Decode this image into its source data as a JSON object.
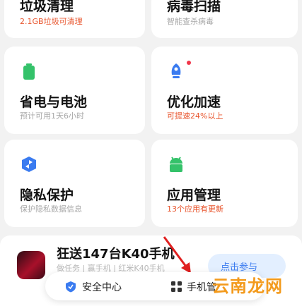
{
  "cards": [
    {
      "title": "垃圾清理",
      "sub": "2.1GB垃圾可清理",
      "sub_color": "orange",
      "icon": "trash-icon"
    },
    {
      "title": "病毒扫描",
      "sub": "智能查杀病毒",
      "sub_color": "gray",
      "icon": "virus-scan-icon"
    },
    {
      "title": "省电与电池",
      "sub": "预计可用1天6小时",
      "sub_color": "gray",
      "icon": "battery-icon"
    },
    {
      "title": "优化加速",
      "sub": "可提速24%以上",
      "sub_color": "orange",
      "icon": "rocket-icon"
    },
    {
      "title": "隐私保护",
      "sub": "保护隐私数据信息",
      "sub_color": "gray",
      "icon": "privacy-shield-icon"
    },
    {
      "title": "应用管理",
      "sub": "13个应用有更新",
      "sub_color": "orange",
      "icon": "android-icon"
    }
  ],
  "promo": {
    "title": "狂送147台K40手机",
    "sub": "做任务 | 赢手机 | 红米K40手机",
    "button": "点击参与"
  },
  "bottom_nav": {
    "security": "安全中心",
    "phone": "手机管"
  },
  "watermark": "云南龙网",
  "colors": {
    "green": "#34c26a",
    "blue": "#3a7bf0",
    "orange": "#e8542c",
    "red_dot": "#f0364a"
  }
}
